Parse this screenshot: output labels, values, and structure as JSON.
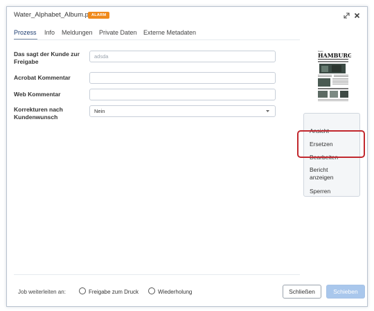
{
  "window": {
    "filename": "Water_Alphabet_Album.pdf",
    "badge": "ALARM"
  },
  "tabs": [
    {
      "label": "Prozess",
      "active": true
    },
    {
      "label": "Info"
    },
    {
      "label": "Meldungen"
    },
    {
      "label": "Private Daten"
    },
    {
      "label": "Externe Metadaten"
    }
  ],
  "form": {
    "customer_feedback_label": "Das sagt der Kunde zur Freigabe",
    "customer_feedback_value": "adsda",
    "acrobat_comment_label": "Acrobat Kommentar",
    "acrobat_comment_value": "",
    "web_comment_label": "Web Kommentar",
    "web_comment_value": "",
    "corrections_label": "Korrekturen nach Kundenwunsch",
    "corrections_value": "Nein"
  },
  "thumbnail": {
    "masthead": "HAMBURG"
  },
  "side_menu": {
    "items": [
      "Ansicht",
      "Ersetzen",
      "Bearbeiten",
      "Bericht anzeigen",
      "Sperren"
    ]
  },
  "footer": {
    "forward_label": "Job weiterleiten an:",
    "radio_release": "Freigabe zum Druck",
    "radio_repeat": "Wiederholung",
    "close_button": "Schließen",
    "push_button": "Schieben"
  },
  "colors": {
    "badge": "#f08a1c",
    "highlight": "#c1272d",
    "primary_button": "#a9c7ec",
    "active_tab": "#1a3a6e"
  }
}
